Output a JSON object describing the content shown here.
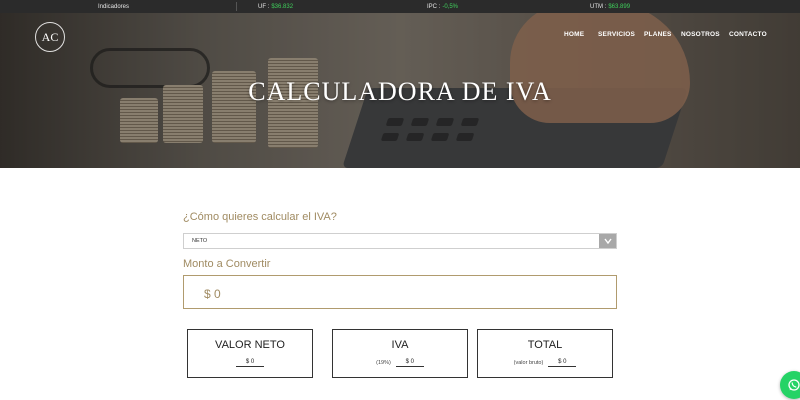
{
  "topbar": {
    "indicadores": "Indicadores",
    "uf_label": "UF :",
    "uf_value": "$36.832",
    "ipc_label": "IPC :",
    "ipc_value": "-0,5%",
    "utm_label": "UTM :",
    "utm_value": "$63.899"
  },
  "logo": {
    "text": "AC"
  },
  "nav": {
    "items": [
      "HOME",
      "SERVICIOS",
      "PLANES",
      "NOSOTROS",
      "CONTACTO"
    ]
  },
  "hero": {
    "title": "CALCULADORA DE IVA"
  },
  "form": {
    "question": "¿Cómo quieres calcular el IVA?",
    "select_value": "NETO",
    "monto_label": "Monto a Convertir",
    "monto_value": "$ 0"
  },
  "cards": [
    {
      "title": "VALOR NETO",
      "note": "",
      "value": "$ 0"
    },
    {
      "title": "IVA",
      "note": "(19%)",
      "value": "$ 0"
    },
    {
      "title": "TOTAL",
      "note": "(valor bruto)",
      "value": "$ 0"
    }
  ],
  "colors": {
    "accent": "#a08b62",
    "indicator_value": "#3fcf5b",
    "whatsapp": "#25d366"
  },
  "icons": {
    "select": "chevron-down-icon",
    "whatsapp": "whatsapp-icon"
  }
}
